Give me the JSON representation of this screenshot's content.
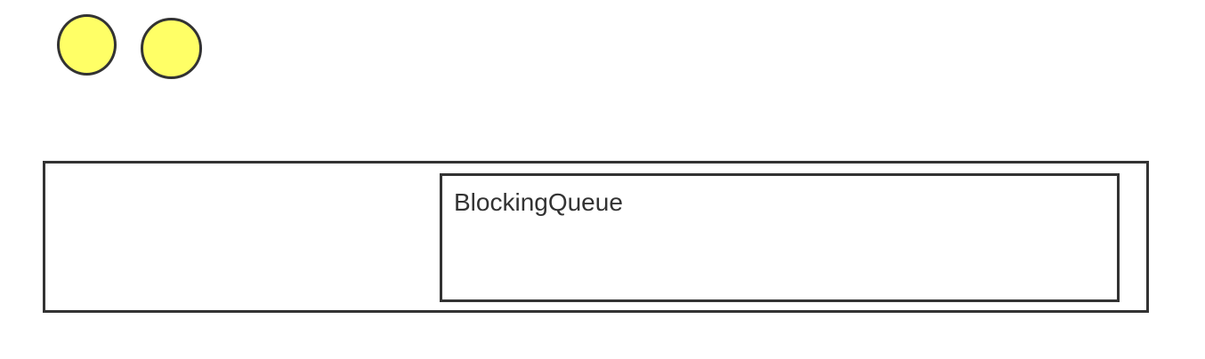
{
  "colors": {
    "thread_fill": "#ffff66",
    "stroke": "#333333",
    "background": "#ffffff"
  },
  "threads": [
    {
      "shape": "circle"
    },
    {
      "shape": "circle"
    }
  ],
  "blocking_queue": {
    "label": "BlockingQueue"
  }
}
